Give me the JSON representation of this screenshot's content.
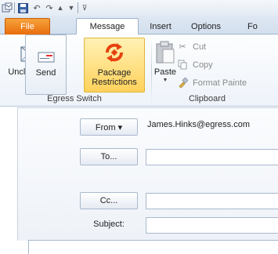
{
  "quick_access": {
    "icons": [
      "outlook-icon",
      "save-icon",
      "undo-icon",
      "redo-icon",
      "up-arrow-icon",
      "down-arrow-icon",
      "customize-icon"
    ]
  },
  "tabs": [
    {
      "label": "File"
    },
    {
      "label": "Message"
    },
    {
      "label": "Insert"
    },
    {
      "label": "Options"
    },
    {
      "label": "Fo"
    }
  ],
  "ribbon": {
    "egress_switch": {
      "unclassified_label": "Unclassified",
      "package_line1": "Package",
      "package_line2": "Restrictions",
      "group_label": "Egress Switch"
    },
    "clipboard": {
      "paste_label": "Paste",
      "cut_label": "Cut",
      "copy_label": "Copy",
      "format_painter_label": "Format Painte",
      "group_label": "Clipboard"
    }
  },
  "compose": {
    "send_label": "Send",
    "from_label": "From ▾",
    "from_address": "James.Hinks@egress.com",
    "to_label": "To...",
    "cc_label": "Cc...",
    "subject_label": "Subject:",
    "to_value": "",
    "cc_value": "",
    "subject_value": ""
  },
  "colors": {
    "file_tab": "#e86d0c",
    "highlight_button": "#ffd25c",
    "package_icon": "#e5420f"
  }
}
